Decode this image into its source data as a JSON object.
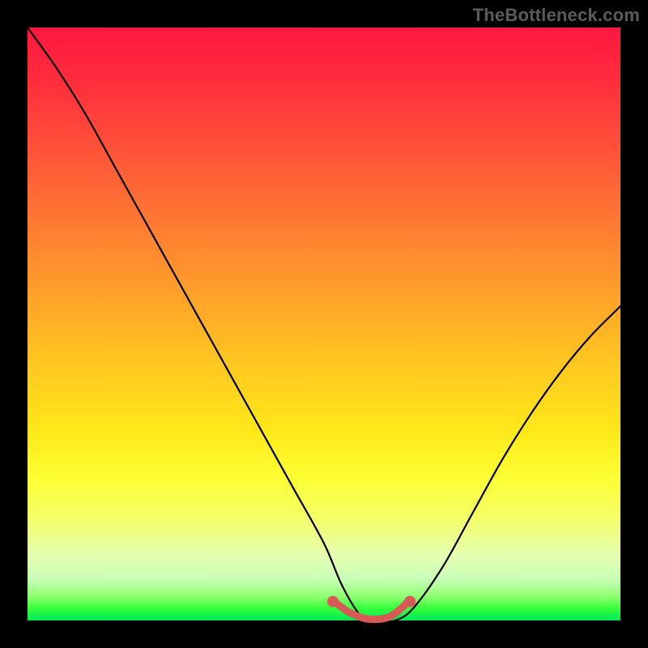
{
  "watermark": "TheBottleneck.com",
  "chart_data": {
    "type": "line",
    "title": "",
    "xlabel": "",
    "ylabel": "",
    "xlim": [
      0,
      100
    ],
    "ylim": [
      0,
      100
    ],
    "grid": false,
    "legend": false,
    "series": [
      {
        "name": "bottleneck-curve",
        "color": "#000000",
        "x": [
          0,
          5,
          10,
          15,
          20,
          25,
          30,
          35,
          40,
          45,
          50,
          53,
          56,
          58,
          60,
          62,
          65,
          70,
          75,
          80,
          85,
          90,
          95,
          100
        ],
        "y": [
          100,
          93,
          85,
          76,
          67,
          58,
          49,
          40,
          31,
          22,
          13,
          6,
          1,
          0,
          0,
          0,
          2,
          9,
          18,
          27,
          35,
          42,
          48,
          53
        ]
      },
      {
        "name": "bottom-highlight",
        "color": "#d85a56",
        "x": [
          52,
          53,
          54,
          55,
          56,
          57,
          58,
          59,
          60,
          61,
          62,
          63,
          64
        ],
        "y": [
          3,
          2.2,
          1.5,
          1.0,
          0.6,
          0.3,
          0.2,
          0.2,
          0.3,
          0.6,
          1.2,
          2.0,
          3.0
        ]
      }
    ],
    "markers": [
      {
        "name": "highlight-dot-left",
        "x": 51.5,
        "y": 3.2,
        "color": "#d85a56"
      },
      {
        "name": "highlight-dot-right",
        "x": 64.5,
        "y": 3.2,
        "color": "#d85a56"
      }
    ]
  }
}
